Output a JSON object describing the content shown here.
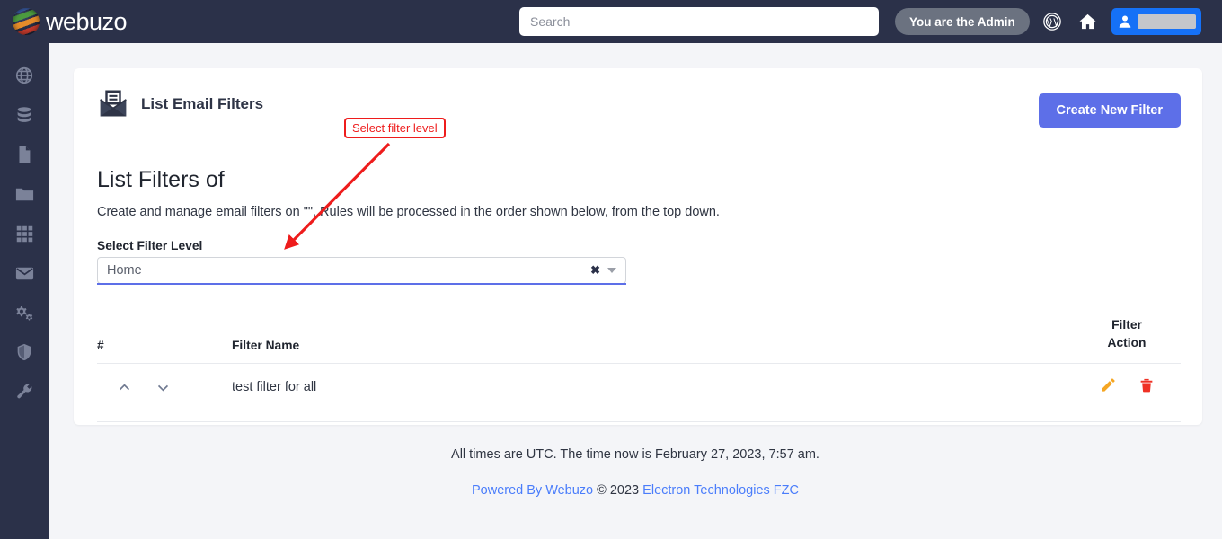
{
  "topbar": {
    "brand": "webuzo",
    "search_placeholder": "Search",
    "admin_badge": "You are the Admin",
    "icons": [
      "wordpress-icon",
      "home-icon",
      "user-icon"
    ]
  },
  "sidebar": {
    "items": [
      {
        "icon": "globe-icon"
      },
      {
        "icon": "database-icon"
      },
      {
        "icon": "file-icon"
      },
      {
        "icon": "folder-icon"
      },
      {
        "icon": "grid-icon"
      },
      {
        "icon": "envelope-icon"
      },
      {
        "icon": "gears-icon"
      },
      {
        "icon": "shield-icon"
      },
      {
        "icon": "wrench-icon"
      }
    ]
  },
  "card": {
    "title": "List Email Filters",
    "icon": "email-filter-icon",
    "create_button": "Create New Filter",
    "section_title": "List Filters of",
    "section_desc": "Create and manage email filters on \"\". Rules will be processed in the order shown below, from the top down.",
    "filter_level": {
      "label": "Select Filter Level",
      "value": "Home",
      "clear_symbol": "✖"
    },
    "table": {
      "headers": {
        "num": "#",
        "name": "Filter Name",
        "action_line1": "Filter",
        "action_line2": "Action"
      },
      "rows": [
        {
          "name": "test filter for all",
          "move_up": "chevron-up-icon",
          "move_down": "chevron-down-icon",
          "edit": "edit-pencil-icon",
          "delete": "trash-icon"
        }
      ]
    }
  },
  "annotation": {
    "label": "Select filter level",
    "color": "#ee1c1c"
  },
  "footer": {
    "time_line": "All times are UTC. The time now is February 27, 2023, 7:57 am.",
    "powered_by": "Powered By Webuzo",
    "copyright": "© 2023",
    "company": "Electron Technologies FZC"
  },
  "colors": {
    "navy": "#2b3149",
    "accent": "#5d6fe8",
    "user_button": "#1571f7",
    "link": "#4a7dfb",
    "edit": "#f5a623",
    "delete": "#ef3124"
  }
}
